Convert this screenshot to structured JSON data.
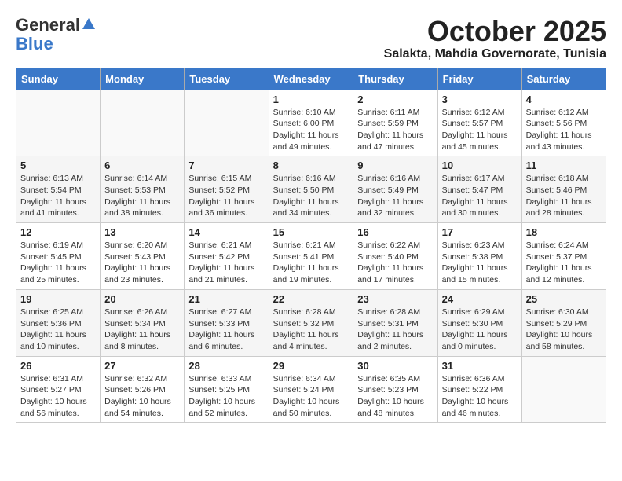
{
  "header": {
    "logo_general": "General",
    "logo_blue": "Blue",
    "month_year": "October 2025",
    "location": "Salakta, Mahdia Governorate, Tunisia"
  },
  "days_of_week": [
    "Sunday",
    "Monday",
    "Tuesday",
    "Wednesday",
    "Thursday",
    "Friday",
    "Saturday"
  ],
  "weeks": [
    [
      {
        "day": "",
        "info": ""
      },
      {
        "day": "",
        "info": ""
      },
      {
        "day": "",
        "info": ""
      },
      {
        "day": "1",
        "info": "Sunrise: 6:10 AM\nSunset: 6:00 PM\nDaylight: 11 hours\nand 49 minutes."
      },
      {
        "day": "2",
        "info": "Sunrise: 6:11 AM\nSunset: 5:59 PM\nDaylight: 11 hours\nand 47 minutes."
      },
      {
        "day": "3",
        "info": "Sunrise: 6:12 AM\nSunset: 5:57 PM\nDaylight: 11 hours\nand 45 minutes."
      },
      {
        "day": "4",
        "info": "Sunrise: 6:12 AM\nSunset: 5:56 PM\nDaylight: 11 hours\nand 43 minutes."
      }
    ],
    [
      {
        "day": "5",
        "info": "Sunrise: 6:13 AM\nSunset: 5:54 PM\nDaylight: 11 hours\nand 41 minutes."
      },
      {
        "day": "6",
        "info": "Sunrise: 6:14 AM\nSunset: 5:53 PM\nDaylight: 11 hours\nand 38 minutes."
      },
      {
        "day": "7",
        "info": "Sunrise: 6:15 AM\nSunset: 5:52 PM\nDaylight: 11 hours\nand 36 minutes."
      },
      {
        "day": "8",
        "info": "Sunrise: 6:16 AM\nSunset: 5:50 PM\nDaylight: 11 hours\nand 34 minutes."
      },
      {
        "day": "9",
        "info": "Sunrise: 6:16 AM\nSunset: 5:49 PM\nDaylight: 11 hours\nand 32 minutes."
      },
      {
        "day": "10",
        "info": "Sunrise: 6:17 AM\nSunset: 5:47 PM\nDaylight: 11 hours\nand 30 minutes."
      },
      {
        "day": "11",
        "info": "Sunrise: 6:18 AM\nSunset: 5:46 PM\nDaylight: 11 hours\nand 28 minutes."
      }
    ],
    [
      {
        "day": "12",
        "info": "Sunrise: 6:19 AM\nSunset: 5:45 PM\nDaylight: 11 hours\nand 25 minutes."
      },
      {
        "day": "13",
        "info": "Sunrise: 6:20 AM\nSunset: 5:43 PM\nDaylight: 11 hours\nand 23 minutes."
      },
      {
        "day": "14",
        "info": "Sunrise: 6:21 AM\nSunset: 5:42 PM\nDaylight: 11 hours\nand 21 minutes."
      },
      {
        "day": "15",
        "info": "Sunrise: 6:21 AM\nSunset: 5:41 PM\nDaylight: 11 hours\nand 19 minutes."
      },
      {
        "day": "16",
        "info": "Sunrise: 6:22 AM\nSunset: 5:40 PM\nDaylight: 11 hours\nand 17 minutes."
      },
      {
        "day": "17",
        "info": "Sunrise: 6:23 AM\nSunset: 5:38 PM\nDaylight: 11 hours\nand 15 minutes."
      },
      {
        "day": "18",
        "info": "Sunrise: 6:24 AM\nSunset: 5:37 PM\nDaylight: 11 hours\nand 12 minutes."
      }
    ],
    [
      {
        "day": "19",
        "info": "Sunrise: 6:25 AM\nSunset: 5:36 PM\nDaylight: 11 hours\nand 10 minutes."
      },
      {
        "day": "20",
        "info": "Sunrise: 6:26 AM\nSunset: 5:34 PM\nDaylight: 11 hours\nand 8 minutes."
      },
      {
        "day": "21",
        "info": "Sunrise: 6:27 AM\nSunset: 5:33 PM\nDaylight: 11 hours\nand 6 minutes."
      },
      {
        "day": "22",
        "info": "Sunrise: 6:28 AM\nSunset: 5:32 PM\nDaylight: 11 hours\nand 4 minutes."
      },
      {
        "day": "23",
        "info": "Sunrise: 6:28 AM\nSunset: 5:31 PM\nDaylight: 11 hours\nand 2 minutes."
      },
      {
        "day": "24",
        "info": "Sunrise: 6:29 AM\nSunset: 5:30 PM\nDaylight: 11 hours\nand 0 minutes."
      },
      {
        "day": "25",
        "info": "Sunrise: 6:30 AM\nSunset: 5:29 PM\nDaylight: 10 hours\nand 58 minutes."
      }
    ],
    [
      {
        "day": "26",
        "info": "Sunrise: 6:31 AM\nSunset: 5:27 PM\nDaylight: 10 hours\nand 56 minutes."
      },
      {
        "day": "27",
        "info": "Sunrise: 6:32 AM\nSunset: 5:26 PM\nDaylight: 10 hours\nand 54 minutes."
      },
      {
        "day": "28",
        "info": "Sunrise: 6:33 AM\nSunset: 5:25 PM\nDaylight: 10 hours\nand 52 minutes."
      },
      {
        "day": "29",
        "info": "Sunrise: 6:34 AM\nSunset: 5:24 PM\nDaylight: 10 hours\nand 50 minutes."
      },
      {
        "day": "30",
        "info": "Sunrise: 6:35 AM\nSunset: 5:23 PM\nDaylight: 10 hours\nand 48 minutes."
      },
      {
        "day": "31",
        "info": "Sunrise: 6:36 AM\nSunset: 5:22 PM\nDaylight: 10 hours\nand 46 minutes."
      },
      {
        "day": "",
        "info": ""
      }
    ]
  ]
}
